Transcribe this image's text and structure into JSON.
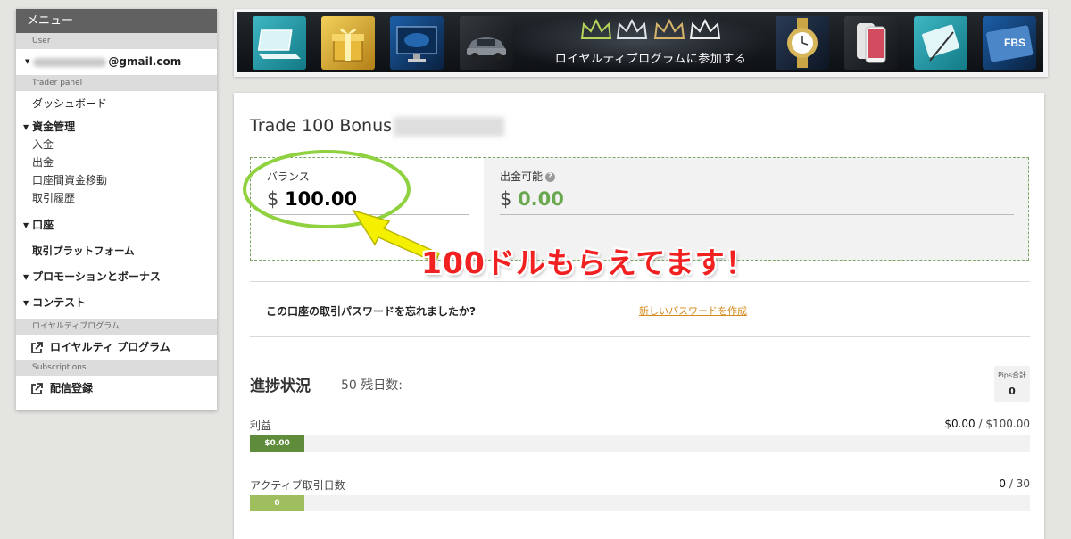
{
  "sidebar": {
    "title": "メニュー",
    "sections": {
      "user": "User",
      "trader_panel": "Trader panel",
      "loyalty": "ロイヤルティプログラム",
      "subscriptions": "Subscriptions"
    },
    "user_email": "@gmail.com",
    "dashboard": "ダッシュボード",
    "funds": {
      "label": "資金管理",
      "items": [
        "入金",
        "出金",
        "口座間資金移動",
        "取引履歴"
      ]
    },
    "accounts": "口座",
    "platforms": "取引プラットフォーム",
    "promotions": "プロモーションとボーナス",
    "contests": "コンテスト",
    "loyalty_link": "ロイヤルティ プログラム",
    "subscribe_link": "配信登録"
  },
  "banner": {
    "text": "ロイヤルティプログラムに参加する",
    "logo": "FBS"
  },
  "account": {
    "title": "Trade 100 Bonus",
    "balance_label": "バランス",
    "currency": "$",
    "balance": "100.00",
    "withdrawable_label": "出金可能",
    "withdrawable": "0.00",
    "help": "?",
    "password_question": "この口座の取引パスワードを忘れましたか?",
    "password_link": "新しいパスワードを作成"
  },
  "progress": {
    "title": "進捗状況",
    "days": "50 残日数:",
    "pips_label": "Pips合計",
    "pips_value": "0",
    "profit_label": "利益",
    "profit_current": "$0.00",
    "profit_target": "/ $100.00",
    "profit_bar": "$0.00",
    "days_label": "アクティブ取引日数",
    "days_current": "0",
    "days_target": "/ 30",
    "days_bar": "0"
  },
  "annotation": {
    "text": "100ドルもらえてます！"
  },
  "colors": {
    "sidebar_header": "#616161",
    "green_value": "#6aa84f",
    "link_orange": "#d58a1b",
    "annotation_red": "#f22121",
    "annotation_ellipse": "#8fd13f",
    "arrow_yellow": "#f5f000"
  }
}
